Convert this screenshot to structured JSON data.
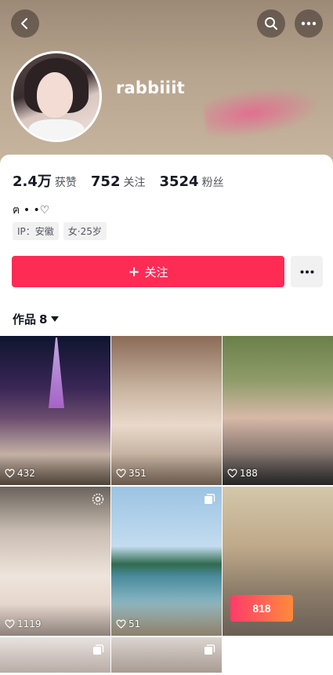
{
  "header": {
    "username": "rabbiiit"
  },
  "stats": [
    {
      "value": "2.4万",
      "label": "获赞"
    },
    {
      "value": "752",
      "label": "关注"
    },
    {
      "value": "3524",
      "label": "粉丝"
    }
  ],
  "bio": "ฅ • •♡",
  "tags": [
    "IP：安徽",
    "女·25岁"
  ],
  "actions": {
    "follow_label": "关注"
  },
  "works": {
    "label": "作品",
    "count": "8"
  },
  "grid": {
    "items": [
      {
        "likes": "432"
      },
      {
        "likes": "351"
      },
      {
        "likes": "188"
      },
      {
        "likes": "1119"
      },
      {
        "likes": "51"
      },
      {
        "likes": ""
      }
    ],
    "promo_text": "818"
  },
  "colors": {
    "accent": "#fe2c55",
    "secondary_button": "#f1f1f2"
  }
}
